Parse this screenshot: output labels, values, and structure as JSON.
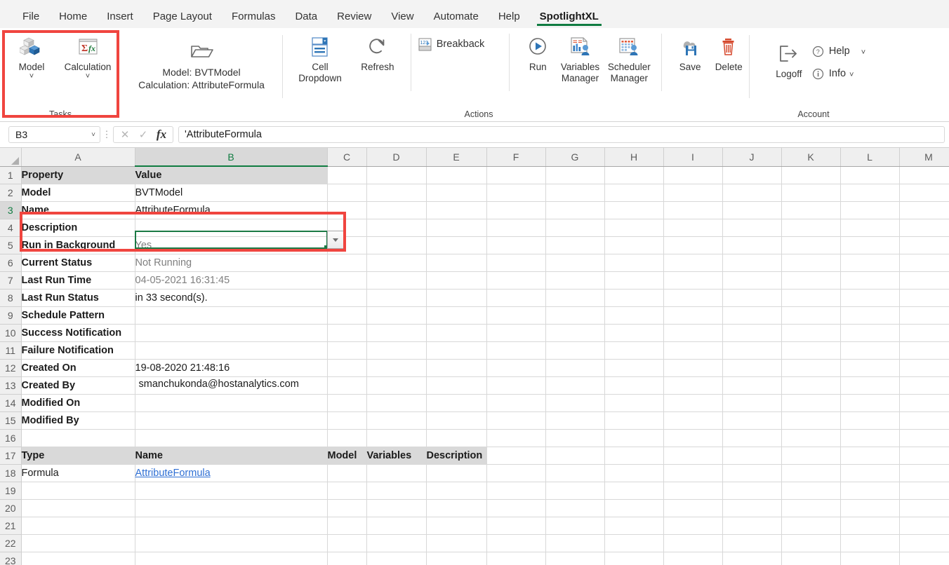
{
  "ribbon_tabs": [
    {
      "label": "File",
      "active": false
    },
    {
      "label": "Home",
      "active": false
    },
    {
      "label": "Insert",
      "active": false
    },
    {
      "label": "Page Layout",
      "active": false
    },
    {
      "label": "Formulas",
      "active": false
    },
    {
      "label": "Data",
      "active": false
    },
    {
      "label": "Review",
      "active": false
    },
    {
      "label": "View",
      "active": false
    },
    {
      "label": "Automate",
      "active": false
    },
    {
      "label": "Help",
      "active": false
    },
    {
      "label": "SpotlightXL",
      "active": true
    }
  ],
  "ribbon": {
    "accent_color": "#107c41",
    "highlight_color": "#f0453f",
    "groups": [
      {
        "name": "Tasks",
        "label": "Tasks",
        "highlighted": true,
        "buttons": [
          {
            "label": "Model",
            "icon": "cubes-icon",
            "has_chevron": true
          },
          {
            "label": "Calculation",
            "icon": "sigma-fx-icon",
            "has_chevron": true
          }
        ]
      },
      {
        "name": "context",
        "label": "",
        "highlighted": false,
        "buttons": [
          {
            "label": "Model: BVTModel\nCalculation: AttributeFormula",
            "icon": "open-folder-icon",
            "has_inline_chevron": true
          }
        ]
      },
      {
        "name": "actions",
        "label": "Actions",
        "highlighted": false,
        "buttons": [
          {
            "label": "Cell\nDropdown",
            "icon": "cell-dropdown-icon",
            "has_inline_chevron": true
          },
          {
            "label": "Refresh",
            "icon": "refresh-icon"
          },
          {
            "label": "Breakback",
            "icon": "breakback-icon",
            "inline": true
          },
          {
            "label": "Run",
            "icon": "run-play-icon"
          },
          {
            "label": "Variables\nManager",
            "icon": "variables-manager-icon"
          },
          {
            "label": "Scheduler\nManager",
            "icon": "scheduler-manager-icon"
          },
          {
            "label": "Save",
            "icon": "cloud-save-icon"
          },
          {
            "label": "Delete",
            "icon": "trash-icon"
          }
        ]
      },
      {
        "name": "account",
        "label": "Account",
        "highlighted": false,
        "buttons": [
          {
            "label": "Logoff",
            "icon": "logoff-icon"
          },
          {
            "label": "Help",
            "icon": "help-circle-icon",
            "has_chevron": true
          },
          {
            "label": "Info",
            "icon": "info-circle-icon",
            "has_chevron": true
          }
        ]
      }
    ]
  },
  "formula_bar": {
    "name_box_value": "B3",
    "cancel_icon": "cancel-x-icon",
    "confirm_icon": "confirm-check-icon",
    "fx_icon": "fx-icon",
    "formula_value": "'AttributeFormula"
  },
  "grid": {
    "columns": [
      "A",
      "B",
      "C",
      "D",
      "E",
      "F",
      "G",
      "H",
      "I",
      "J",
      "K",
      "L",
      "M"
    ],
    "selected_column": "B",
    "selected_row": 3,
    "active_cell": "B3",
    "active_cell_has_dropdown": true,
    "rows": [
      {
        "n": 1,
        "a": "Property",
        "b": "Value",
        "style": "header"
      },
      {
        "n": 2,
        "a": "Model",
        "b": "BVTModel",
        "style": "label-value"
      },
      {
        "n": 3,
        "a": "Name",
        "b": "AttributeFormula",
        "style": "label-value"
      },
      {
        "n": 4,
        "a": "Description",
        "b": "",
        "style": "label-value"
      },
      {
        "n": 5,
        "a": "Run in Background",
        "b": "Yes",
        "style": "label-value-gray"
      },
      {
        "n": 6,
        "a": "Current Status",
        "b": "Not Running",
        "style": "label-value-gray"
      },
      {
        "n": 7,
        "a": "Last Run Time",
        "b": "04-05-2021 16:31:45",
        "style": "label-value-gray"
      },
      {
        "n": 8,
        "a": "Last Run Status",
        "b": "in 33 second(s).",
        "style": "label-value"
      },
      {
        "n": 9,
        "a": "Schedule Pattern",
        "b": "",
        "style": "label-value"
      },
      {
        "n": 10,
        "a": "Success Notification",
        "b": "",
        "style": "label-value"
      },
      {
        "n": 11,
        "a": "Failure Notification",
        "b": "",
        "style": "label-value"
      },
      {
        "n": 12,
        "a": "Created On",
        "b": "19-08-2020 21:48:16",
        "style": "label-value"
      },
      {
        "n": 13,
        "a": "Created By",
        "b": "smanchukonda@hostanalytics.com",
        "style": "label-value-overflow"
      },
      {
        "n": 14,
        "a": "Modified On",
        "b": "",
        "style": "label-value"
      },
      {
        "n": 15,
        "a": "Modified By",
        "b": "",
        "style": "label-value"
      },
      {
        "n": 16,
        "a": "",
        "b": "",
        "style": "empty"
      },
      {
        "n": 17,
        "a": "Type",
        "b": "Name",
        "c": "Model",
        "d": "Variables",
        "e": "Description",
        "style": "table-header"
      },
      {
        "n": 18,
        "a": "Formula",
        "b": "AttributeFormula",
        "style": "table-row-link"
      },
      {
        "n": 19,
        "a": "",
        "b": "",
        "style": "empty"
      },
      {
        "n": 20,
        "a": "",
        "b": "",
        "style": "empty"
      },
      {
        "n": 21,
        "a": "",
        "b": "",
        "style": "empty"
      },
      {
        "n": 22,
        "a": "",
        "b": "",
        "style": "empty"
      },
      {
        "n": 23,
        "a": "",
        "b": "",
        "style": "empty"
      }
    ]
  }
}
